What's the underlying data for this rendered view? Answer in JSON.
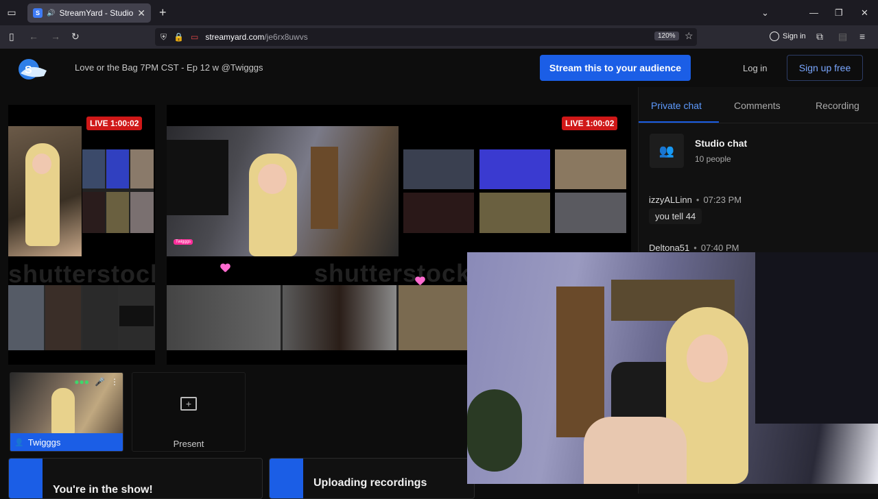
{
  "browser": {
    "tab_title": "StreamYard - Studio",
    "url_host": "streamyard.com",
    "url_path": "/je6rx8uwvs",
    "zoom": "120%",
    "sign_in": "Sign in"
  },
  "header": {
    "show_title": "Love or the Bag 7PM CST - Ep 12 w @Twigggs",
    "stream_button": "Stream this to your audience",
    "login": "Log in",
    "signup": "Sign up free"
  },
  "stage": {
    "live_badge_left": "LIVE 1:00:02",
    "live_badge_main": "LIVE 1:00:02",
    "watermark": "shutterstock",
    "main_name_chip": "Twigggs"
  },
  "participants": {
    "self_name": "Twigggs",
    "present_label": "Present"
  },
  "cards": {
    "in_show": "You're in the show!",
    "uploading": "Uploading recordings"
  },
  "sidebar": {
    "tabs": [
      "Private chat",
      "Comments",
      "Recording"
    ],
    "chat_title": "Studio chat",
    "chat_count": "10 people",
    "messages": [
      {
        "user": "izzyALLinn",
        "time": "07:23 PM",
        "text": "you tell 44"
      },
      {
        "user": "Deltona51",
        "time": "07:40 PM"
      }
    ]
  },
  "colors": {
    "accent": "#1b5ee6",
    "live": "#d01818",
    "tab_active_text": "#5e9bff"
  }
}
